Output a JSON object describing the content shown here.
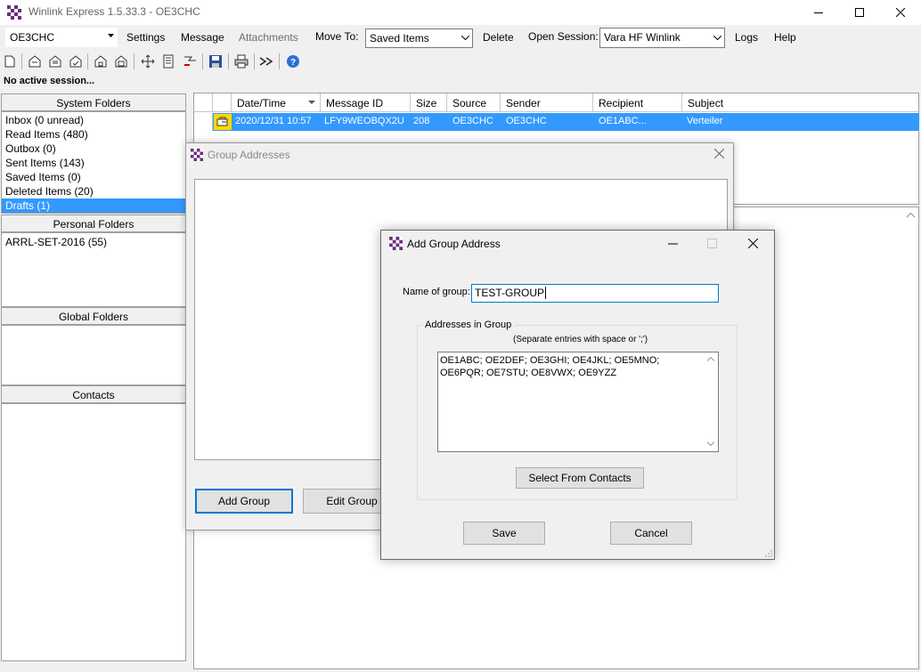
{
  "window": {
    "title": "Winlink Express 1.5.33.3 - OE3CHC"
  },
  "menu": {
    "callsign": "OE3CHC",
    "settings": "Settings",
    "message": "Message",
    "attachments": "Attachments",
    "move_to_label": "Move To:",
    "move_to_value": "Saved Items",
    "delete": "Delete",
    "open_session_label": "Open Session:",
    "open_session_value": "Vara HF Winlink",
    "logs": "Logs",
    "help": "Help"
  },
  "status": "No active session...",
  "folders": {
    "system_header": "System Folders",
    "system": [
      "Inbox  (0 unread)",
      "Read Items  (480)",
      "Outbox  (0)",
      "Sent Items  (143)",
      "Saved Items  (0)",
      "Deleted Items  (20)",
      "Drafts  (1)"
    ],
    "personal_header": "Personal Folders",
    "personal": [
      "ARRL-SET-2016  (55)"
    ],
    "global_header": "Global Folders",
    "contacts_header": "Contacts"
  },
  "message_list": {
    "columns": [
      "Date/Time",
      "Message ID",
      "Size",
      "Source",
      "Sender",
      "Recipient",
      "Subject"
    ],
    "rows": [
      {
        "datetime": "2020/12/31 10:57",
        "message_id": "LFY9WEOBQX2U",
        "size": "208",
        "source": "OE3CHC",
        "sender": "OE3CHC",
        "recipient": "OE1ABC...",
        "subject": "Verteiler"
      }
    ]
  },
  "group_dialog": {
    "title": "Group Addresses",
    "add_group": "Add Group",
    "edit_group": "Edit Group"
  },
  "add_dialog": {
    "title": "Add Group Address",
    "name_label": "Name of group:",
    "name_value": "TEST-GROUP",
    "addresses_legend": "Addresses in Group",
    "separate_hint": "(Separate entries with space or ';')",
    "addresses_value": "OE1ABC; OE2DEF; OE3GHI; OE4JKL; OE5MNO; OE6PQR; OE7STU; OE8VWX; OE9YZZ",
    "select_contacts": "Select From Contacts",
    "save": "Save",
    "cancel": "Cancel"
  },
  "colors": {
    "selection": "#3399ff",
    "focus_border": "#0078d7",
    "app_icon_dark": "#6b2d7a"
  }
}
